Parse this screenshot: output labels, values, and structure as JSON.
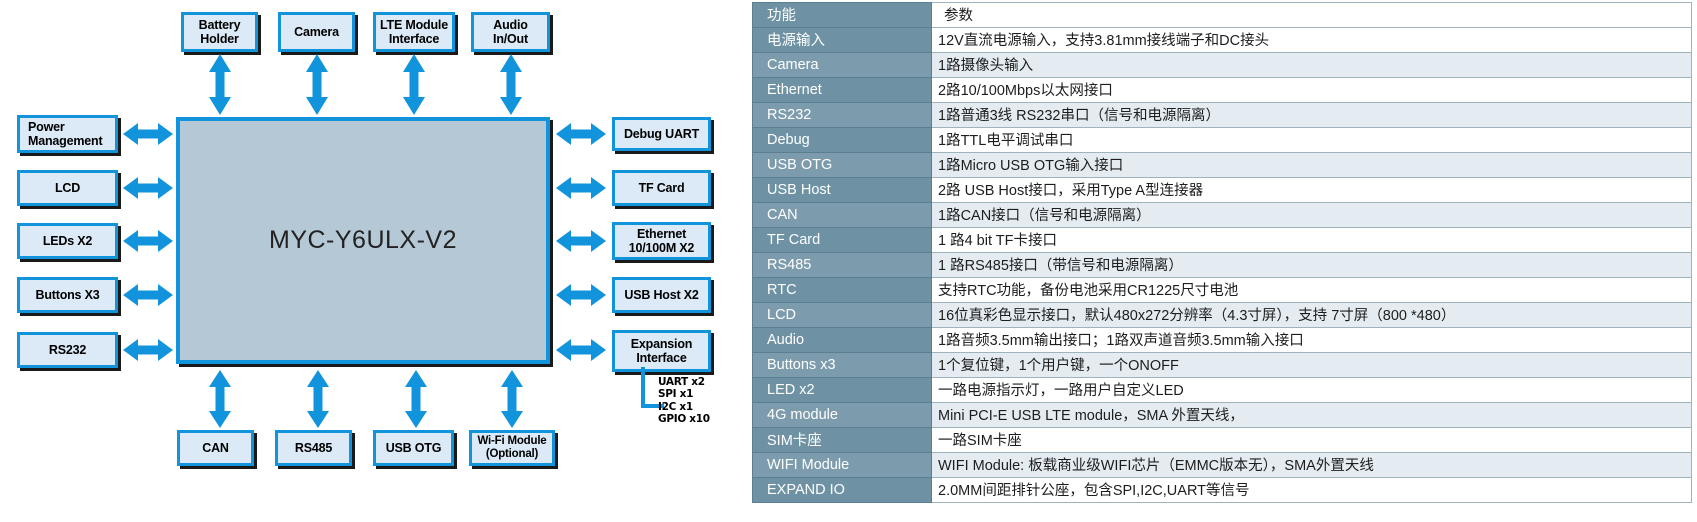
{
  "diagram": {
    "soc": {
      "label": "MYC-Y6ULX-V2"
    },
    "top_blocks": [
      {
        "lines": [
          "Battery",
          "Holder"
        ]
      },
      {
        "lines": [
          "Camera"
        ]
      },
      {
        "lines": [
          "LTE Module",
          "Interface"
        ]
      },
      {
        "lines": [
          "Audio",
          "In/Out"
        ]
      }
    ],
    "left_blocks": [
      {
        "lines": [
          "Power",
          "Management"
        ]
      },
      {
        "lines": [
          "LCD"
        ]
      },
      {
        "lines": [
          "LEDs X2"
        ]
      },
      {
        "lines": [
          "Buttons X3"
        ]
      },
      {
        "lines": [
          "RS232"
        ]
      }
    ],
    "right_blocks": [
      {
        "lines": [
          "Debug UART"
        ]
      },
      {
        "lines": [
          "TF Card"
        ]
      },
      {
        "lines": [
          "Ethernet",
          "10/100M X2"
        ]
      },
      {
        "lines": [
          "USB Host X2"
        ]
      },
      {
        "lines": [
          "Expansion",
          "Interface"
        ]
      }
    ],
    "bottom_blocks": [
      {
        "lines": [
          "CAN"
        ]
      },
      {
        "lines": [
          "RS485"
        ]
      },
      {
        "lines": [
          "USB OTG"
        ]
      },
      {
        "lines": [
          "Wi-Fi Module",
          "(Optional)"
        ]
      }
    ],
    "expansion_note": [
      "UART x2",
      "SPI x1",
      "I2C x1",
      "GPIO x10"
    ],
    "colors": {
      "border": "#1294dd",
      "block_fill": "#dceaf7",
      "soc_fill": "#b5c8d6",
      "arrow": "#1294dd",
      "shadow": "#1a1a1a"
    }
  },
  "table": {
    "header": {
      "function": "功能",
      "parameter": "参数"
    },
    "rows": [
      {
        "k": "电源输入",
        "v": "12V直流电源输入，支持3.81mm接线端子和DC接头"
      },
      {
        "k": "Camera",
        "v": "1路摄像头输入"
      },
      {
        "k": "Ethernet",
        "v": "2路10/100Mbps以太网接口"
      },
      {
        "k": "RS232",
        "v": "1路普通3线 RS232串口（信号和电源隔离）"
      },
      {
        "k": "Debug",
        "v": "1路TTL电平调试串口"
      },
      {
        "k": "USB OTG",
        "v": "1路Micro USB OTG输入接口"
      },
      {
        "k": "USB Host",
        "v": "2路 USB Host接口，采用Type A型连接器"
      },
      {
        "k": "CAN",
        "v": "1路CAN接口（信号和电源隔离）"
      },
      {
        "k": "TF Card",
        "v": "1 路4 bit TF卡接口"
      },
      {
        "k": "RS485",
        "v": "1 路RS485接口（带信号和电源隔离）"
      },
      {
        "k": "RTC",
        "v": "支持RTC功能，备份电池采用CR1225尺寸电池"
      },
      {
        "k": "LCD",
        "v": "16位真彩色显示接口，默认480x272分辨率（4.3寸屏），支持 7寸屏（800 *480）"
      },
      {
        "k": "Audio",
        "v": "1路音频3.5mm输出接口；1路双声道音频3.5mm输入接口"
      },
      {
        "k": "Buttons x3",
        "v": "1个复位键，1个用户键，一个ONOFF"
      },
      {
        "k": "LED x2",
        "v": "一路电源指示灯，一路用户自定义LED"
      },
      {
        "k": "4G module",
        "v": "Mini PCI-E USB LTE module，SMA 外置天线，"
      },
      {
        "k": "SIM卡座",
        "v": "一路SIM卡座"
      },
      {
        "k": "WIFI Module",
        "v": "WIFI Module: 板载商业级WIFI芯片（EMMC版本无），SMA外置天线"
      },
      {
        "k": "EXPAND IO",
        "v": "2.0MM间距排针公座，包含SPI,I2C,UART等信号"
      }
    ],
    "colors": {
      "key_bg": "#6e92a4",
      "key_bg_alt": "#7c9cad",
      "val_bg": "#ffffff",
      "val_bg_alt": "#e4ecf2",
      "grid": "#9fb3bf"
    }
  }
}
